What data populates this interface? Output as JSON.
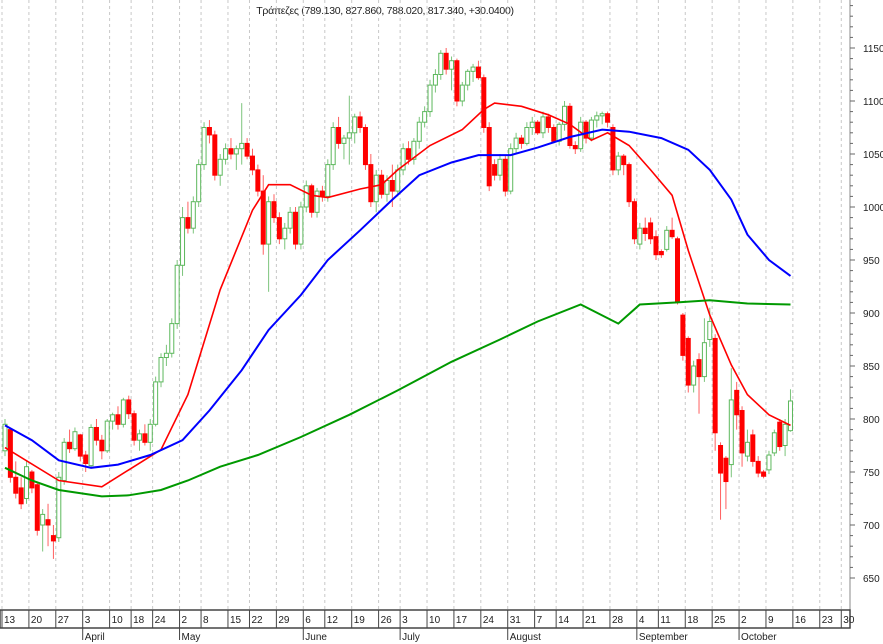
{
  "chart_data": {
    "type": "candlestick",
    "title": "Τράπεζες (789.130, 827.860, 788.020, 817.340, +30.0400)",
    "ylim": [
      623,
      1195
    ],
    "y_ticks": [
      650,
      700,
      750,
      800,
      850,
      900,
      950,
      1000,
      1050,
      1100,
      1150
    ],
    "x_ticks": [
      {
        "label": "13",
        "day": 0
      },
      {
        "label": "20",
        "day": 5
      },
      {
        "label": "27",
        "day": 10
      },
      {
        "label": "3",
        "day": 15
      },
      {
        "label": "10",
        "day": 20
      },
      {
        "label": "18",
        "day": 24
      },
      {
        "label": "24",
        "day": 28
      },
      {
        "label": "2",
        "day": 33
      },
      {
        "label": "8",
        "day": 37
      },
      {
        "label": "15",
        "day": 42
      },
      {
        "label": "22",
        "day": 46
      },
      {
        "label": "29",
        "day": 51
      },
      {
        "label": "6",
        "day": 56
      },
      {
        "label": "12",
        "day": 60
      },
      {
        "label": "19",
        "day": 65
      },
      {
        "label": "26",
        "day": 70
      },
      {
        "label": "3",
        "day": 74
      },
      {
        "label": "10",
        "day": 79
      },
      {
        "label": "17",
        "day": 84
      },
      {
        "label": "24",
        "day": 89
      },
      {
        "label": "31",
        "day": 94
      },
      {
        "label": "7",
        "day": 99
      },
      {
        "label": "14",
        "day": 103
      },
      {
        "label": "21",
        "day": 108
      },
      {
        "label": "28",
        "day": 113
      },
      {
        "label": "4",
        "day": 118
      },
      {
        "label": "11",
        "day": 122
      },
      {
        "label": "18",
        "day": 127
      },
      {
        "label": "25",
        "day": 132
      },
      {
        "label": "2",
        "day": 137
      },
      {
        "label": "9",
        "day": 142
      },
      {
        "label": "16",
        "day": 147
      },
      {
        "label": "23",
        "day": 152
      },
      {
        "label": "30",
        "day": 156
      }
    ],
    "months": [
      {
        "label": "April",
        "day": 15
      },
      {
        "label": "May",
        "day": 33
      },
      {
        "label": "June",
        "day": 56
      },
      {
        "label": "July",
        "day": 74
      },
      {
        "label": "August",
        "day": 94
      },
      {
        "label": "September",
        "day": 118
      },
      {
        "label": "October",
        "day": 137
      }
    ],
    "ohlc": [
      [
        770,
        800,
        765,
        795
      ],
      [
        790,
        792,
        740,
        745
      ],
      [
        745,
        760,
        725,
        730
      ],
      [
        735,
        745,
        715,
        720
      ],
      [
        725,
        760,
        720,
        755
      ],
      [
        750,
        752,
        730,
        735
      ],
      [
        738,
        740,
        690,
        695
      ],
      [
        700,
        715,
        675,
        710
      ],
      [
        705,
        720,
        680,
        700
      ],
      [
        690,
        700,
        668,
        685
      ],
      [
        688,
        750,
        684,
        745
      ],
      [
        742,
        782,
        738,
        778
      ],
      [
        778,
        790,
        768,
        772
      ],
      [
        772,
        792,
        770,
        788
      ],
      [
        785,
        786,
        760,
        765
      ],
      [
        766,
        770,
        750,
        758
      ],
      [
        756,
        795,
        754,
        792
      ],
      [
        792,
        800,
        775,
        780
      ],
      [
        780,
        785,
        762,
        770
      ],
      [
        770,
        800,
        768,
        798
      ],
      [
        798,
        806,
        790,
        804
      ],
      [
        804,
        812,
        790,
        795
      ],
      [
        795,
        820,
        792,
        818
      ],
      [
        818,
        822,
        800,
        805
      ],
      [
        805,
        808,
        775,
        780
      ],
      [
        780,
        790,
        770,
        786
      ],
      [
        786,
        795,
        775,
        778
      ],
      [
        778,
        800,
        770,
        795
      ],
      [
        795,
        840,
        793,
        835
      ],
      [
        835,
        862,
        830,
        858
      ],
      [
        858,
        870,
        850,
        862
      ],
      [
        862,
        895,
        858,
        890
      ],
      [
        890,
        950,
        885,
        945
      ],
      [
        945,
        1000,
        935,
        990
      ],
      [
        990,
        1005,
        975,
        980
      ],
      [
        980,
        1010,
        975,
        1005
      ],
      [
        1005,
        1045,
        1000,
        1040
      ],
      [
        1040,
        1080,
        1035,
        1075
      ],
      [
        1075,
        1082,
        1060,
        1068
      ],
      [
        1068,
        1072,
        1025,
        1030
      ],
      [
        1030,
        1050,
        1020,
        1045
      ],
      [
        1045,
        1060,
        1040,
        1055
      ],
      [
        1055,
        1065,
        1045,
        1050
      ],
      [
        1050,
        1058,
        1035,
        1055
      ],
      [
        1055,
        1098,
        1040,
        1060
      ],
      [
        1060,
        1065,
        1045,
        1048
      ],
      [
        1048,
        1055,
        1030,
        1035
      ],
      [
        1035,
        1040,
        1010,
        1015
      ],
      [
        1015,
        1030,
        955,
        965
      ],
      [
        965,
        1010,
        920,
        1005
      ],
      [
        1005,
        1012,
        985,
        990
      ],
      [
        990,
        995,
        965,
        970
      ],
      [
        970,
        985,
        960,
        980
      ],
      [
        980,
        1000,
        975,
        995
      ],
      [
        995,
        1000,
        960,
        965
      ],
      [
        965,
        1005,
        960,
        1000
      ],
      [
        1000,
        1025,
        995,
        1020
      ],
      [
        1020,
        1022,
        990,
        995
      ],
      [
        995,
        1018,
        990,
        1015
      ],
      [
        1015,
        1020,
        1005,
        1010
      ],
      [
        1010,
        1045,
        1005,
        1040
      ],
      [
        1040,
        1080,
        1035,
        1075
      ],
      [
        1075,
        1085,
        1055,
        1060
      ],
      [
        1060,
        1068,
        1045,
        1065
      ],
      [
        1065,
        1105,
        1040,
        1070
      ],
      [
        1070,
        1088,
        1060,
        1085
      ],
      [
        1085,
        1090,
        1070,
        1075
      ],
      [
        1075,
        1078,
        1035,
        1040
      ],
      [
        1040,
        1050,
        1000,
        1005
      ],
      [
        1005,
        1035,
        995,
        1030
      ],
      [
        1030,
        1035,
        1008,
        1012
      ],
      [
        1012,
        1030,
        1005,
        1025
      ],
      [
        1025,
        1040,
        1000,
        1015
      ],
      [
        1015,
        1040,
        1010,
        1035
      ],
      [
        1035,
        1060,
        1030,
        1055
      ],
      [
        1055,
        1062,
        1040,
        1045
      ],
      [
        1045,
        1065,
        1040,
        1062
      ],
      [
        1062,
        1085,
        1055,
        1080
      ],
      [
        1080,
        1095,
        1075,
        1090
      ],
      [
        1090,
        1120,
        1085,
        1115
      ],
      [
        1115,
        1130,
        1108,
        1125
      ],
      [
        1125,
        1148,
        1120,
        1145
      ],
      [
        1145,
        1150,
        1125,
        1130
      ],
      [
        1130,
        1142,
        1110,
        1138
      ],
      [
        1138,
        1140,
        1095,
        1100
      ],
      [
        1100,
        1118,
        1095,
        1115
      ],
      [
        1115,
        1130,
        1110,
        1128
      ],
      [
        1128,
        1135,
        1118,
        1132
      ],
      [
        1132,
        1138,
        1120,
        1122
      ],
      [
        1122,
        1125,
        1070,
        1075
      ],
      [
        1075,
        1080,
        1015,
        1020
      ],
      [
        1040,
        1045,
        1025,
        1030
      ],
      [
        1030,
        1050,
        1025,
        1045
      ],
      [
        1045,
        1048,
        1010,
        1015
      ],
      [
        1015,
        1060,
        1012,
        1055
      ],
      [
        1055,
        1070,
        1050,
        1065
      ],
      [
        1065,
        1068,
        1055,
        1060
      ],
      [
        1060,
        1080,
        1058,
        1075
      ],
      [
        1075,
        1085,
        1068,
        1080
      ],
      [
        1080,
        1082,
        1068,
        1070
      ],
      [
        1070,
        1090,
        1065,
        1085
      ],
      [
        1085,
        1088,
        1070,
        1075
      ],
      [
        1075,
        1078,
        1060,
        1062
      ],
      [
        1062,
        1080,
        1058,
        1078
      ],
      [
        1078,
        1100,
        1072,
        1095
      ],
      [
        1095,
        1098,
        1055,
        1058
      ],
      [
        1058,
        1062,
        1050,
        1055
      ],
      [
        1055,
        1085,
        1052,
        1080
      ],
      [
        1080,
        1082,
        1060,
        1065
      ],
      [
        1065,
        1085,
        1062,
        1082
      ],
      [
        1082,
        1090,
        1075,
        1086
      ],
      [
        1086,
        1090,
        1078,
        1088
      ],
      [
        1088,
        1090,
        1075,
        1080
      ],
      [
        1075,
        1078,
        1030,
        1035
      ],
      [
        1035,
        1052,
        1030,
        1048
      ],
      [
        1048,
        1050,
        1030,
        1040
      ],
      [
        1040,
        1042,
        1000,
        1005
      ],
      [
        1005,
        1008,
        965,
        970
      ],
      [
        965,
        985,
        960,
        980
      ],
      [
        980,
        990,
        968,
        975
      ],
      [
        985,
        990,
        965,
        970
      ],
      [
        972,
        978,
        950,
        955
      ],
      [
        958,
        960,
        952,
        955
      ],
      [
        960,
        982,
        958,
        978
      ],
      [
        978,
        990,
        970,
        972
      ],
      [
        970,
        972,
        908,
        910
      ],
      [
        898,
        900,
        855,
        860
      ],
      [
        876,
        878,
        825,
        832
      ],
      [
        832,
        855,
        825,
        850
      ],
      [
        856,
        862,
        805,
        840
      ],
      [
        840,
        895,
        835,
        872
      ],
      [
        875,
        905,
        868,
        892
      ],
      [
        876,
        880,
        770,
        787
      ],
      [
        775,
        778,
        705,
        749
      ],
      [
        763,
        765,
        715,
        741
      ],
      [
        757,
        848,
        745,
        818
      ],
      [
        827,
        835,
        790,
        804
      ],
      [
        808,
        812,
        755,
        768
      ],
      [
        765,
        790,
        760,
        778
      ],
      [
        785,
        790,
        755,
        760
      ],
      [
        760,
        765,
        745,
        749
      ],
      [
        750,
        752,
        744,
        746
      ],
      [
        752,
        770,
        748,
        766
      ],
      [
        768,
        790,
        765,
        787
      ],
      [
        797,
        800,
        770,
        774
      ],
      [
        775,
        800,
        765,
        795
      ],
      [
        789,
        828,
        788,
        817
      ]
    ],
    "series": [
      {
        "name": "short moving average",
        "color": "#ff0000",
        "points": [
          [
            0,
            773
          ],
          [
            10,
            742
          ],
          [
            18,
            736
          ],
          [
            23,
            752
          ],
          [
            29,
            771
          ],
          [
            34,
            823
          ],
          [
            40,
            922
          ],
          [
            46,
            997
          ],
          [
            49,
            1021
          ],
          [
            53,
            1021
          ],
          [
            57,
            1011
          ],
          [
            60,
            1009
          ],
          [
            66,
            1017
          ],
          [
            70,
            1021
          ],
          [
            73,
            1035
          ],
          [
            79,
            1058
          ],
          [
            85,
            1073
          ],
          [
            89,
            1092
          ],
          [
            91,
            1098
          ],
          [
            96,
            1095
          ],
          [
            101,
            1087
          ],
          [
            105,
            1078
          ],
          [
            109,
            1063
          ],
          [
            112,
            1070
          ],
          [
            116,
            1058
          ],
          [
            120,
            1035
          ],
          [
            124,
            1011
          ],
          [
            127,
            959
          ],
          [
            131,
            898
          ],
          [
            135,
            851
          ],
          [
            138,
            823
          ],
          [
            142,
            804
          ],
          [
            146,
            794
          ]
        ]
      },
      {
        "name": "medium moving average",
        "color": "#0000ff",
        "points": [
          [
            0,
            794
          ],
          [
            5,
            780
          ],
          [
            10,
            761
          ],
          [
            16,
            754
          ],
          [
            21,
            757
          ],
          [
            27,
            766
          ],
          [
            33,
            780
          ],
          [
            38,
            808
          ],
          [
            44,
            846
          ],
          [
            49,
            884
          ],
          [
            55,
            917
          ],
          [
            60,
            950
          ],
          [
            66,
            978
          ],
          [
            72,
            1007
          ],
          [
            77,
            1030
          ],
          [
            83,
            1042
          ],
          [
            88,
            1049
          ],
          [
            94,
            1049
          ],
          [
            99,
            1056
          ],
          [
            105,
            1066
          ],
          [
            111,
            1073
          ],
          [
            116,
            1071
          ],
          [
            122,
            1065
          ],
          [
            127,
            1054
          ],
          [
            131,
            1035
          ],
          [
            135,
            1007
          ],
          [
            138,
            974
          ],
          [
            142,
            950
          ],
          [
            146,
            935
          ]
        ]
      },
      {
        "name": "long moving average",
        "color": "#009900",
        "points": [
          [
            0,
            754
          ],
          [
            5,
            742
          ],
          [
            10,
            733
          ],
          [
            18,
            727
          ],
          [
            23,
            728
          ],
          [
            29,
            733
          ],
          [
            34,
            742
          ],
          [
            40,
            755
          ],
          [
            47,
            766
          ],
          [
            55,
            783
          ],
          [
            64,
            804
          ],
          [
            73,
            827
          ],
          [
            83,
            854
          ],
          [
            92,
            875
          ],
          [
            99,
            892
          ],
          [
            107,
            908
          ],
          [
            114,
            890
          ],
          [
            118,
            908
          ],
          [
            125,
            910
          ],
          [
            131,
            912
          ],
          [
            138,
            909
          ],
          [
            146,
            908
          ]
        ]
      }
    ],
    "colors": {
      "up": "#5cb85c",
      "up_fill_alt": "#008000",
      "down": "#ff0000",
      "grid": "#c8c8c8"
    }
  }
}
